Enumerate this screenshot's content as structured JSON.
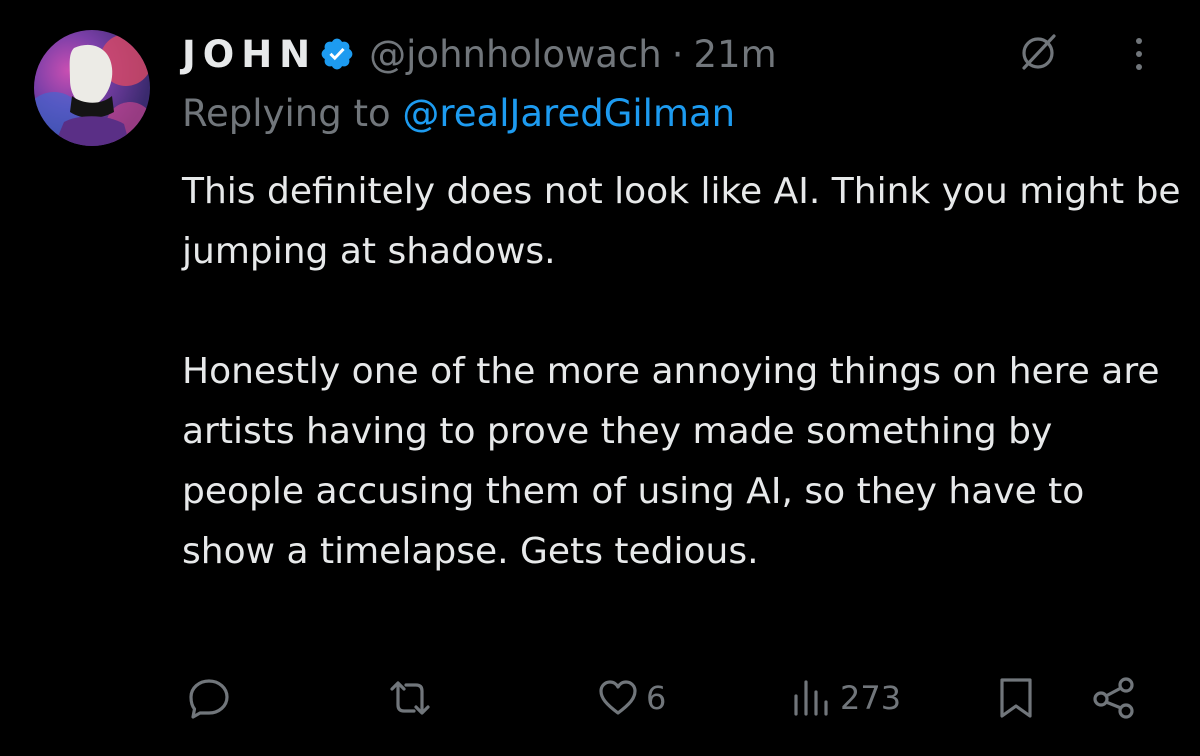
{
  "tweet": {
    "display_name": "JOHN",
    "handle": "@johnholowach",
    "separator": "·",
    "time": "21m",
    "replying_prefix": "Replying to ",
    "replying_to": "@realJaredGilman",
    "paragraphs": [
      "This definitely does not look like AI. Think you might be jumping at shadows.",
      "Honestly one of the more annoying things on here are artists having to prove they made something by people accusing them of using AI, so they have to show a timelapse. Gets tedious."
    ]
  },
  "actions": {
    "reply_count": "",
    "retweet_count": "",
    "like_count": "6",
    "views_count": "273"
  },
  "icons": {
    "verified": "verified-badge-icon",
    "grok": "grok-slash-icon",
    "more": "more-vertical-icon",
    "reply": "reply-icon",
    "retweet": "retweet-icon",
    "like": "heart-icon",
    "views": "views-bar-icon",
    "bookmark": "bookmark-icon",
    "share": "share-icon"
  },
  "colors": {
    "background": "#000000",
    "text": "#e7e9ea",
    "muted": "#71767b",
    "accent": "#1d9bf0"
  }
}
